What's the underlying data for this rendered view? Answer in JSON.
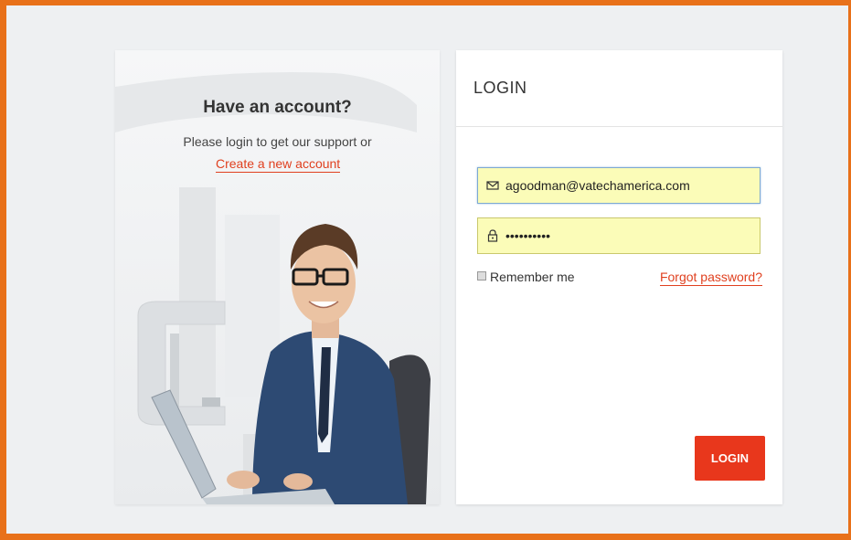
{
  "promo": {
    "title": "Have an account?",
    "subtitle": "Please login to get our support or",
    "create_link": "Create a new account"
  },
  "login_form": {
    "heading": "LOGIN",
    "email_value": "agoodman@vatechamerica.com",
    "password_value": "••••••••••",
    "remember_label": "Remember me",
    "forgot_label": "Forgot password?",
    "submit_label": "LOGIN"
  },
  "icons": {
    "email": "envelope-icon",
    "password": "lock-icon"
  },
  "colors": {
    "frame": "#e8711a",
    "accent": "#e8371c",
    "autofill": "#fbfcb8"
  }
}
